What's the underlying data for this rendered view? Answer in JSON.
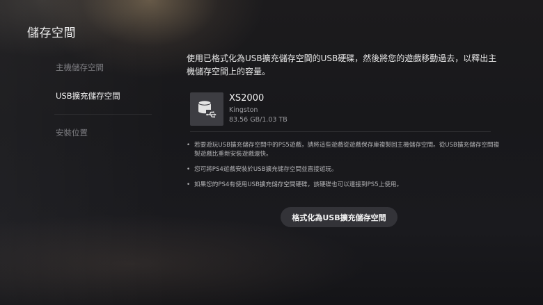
{
  "header": {
    "title": "儲存空間"
  },
  "sidebar": {
    "items": [
      {
        "label": "主機儲存空間",
        "active": false
      },
      {
        "label": "USB擴充儲存空間",
        "active": true
      },
      {
        "label": "安裝位置",
        "active": false
      }
    ]
  },
  "main": {
    "description": "使用已格式化為USB擴充儲存空間的USB硬碟，然後將您的遊戲移動過去，以釋出主機儲存空間上的容量。",
    "device": {
      "icon": "usb-drive-icon",
      "name": "XS2000",
      "brand": "Kingston",
      "capacity": "83.56 GB/1.03 TB"
    },
    "notes": [
      "若要遊玩USB擴充儲存空間中的PS5遊戲，請將這些遊戲從遊戲保存庫複製回主機儲存空間。從USB擴充儲存空間複製遊戲比重新安裝遊戲還快。",
      "您可將PS4遊戲安裝於USB擴充儲存空間並直接遊玩。",
      "如果您的PS4有使用USB擴充儲存空間硬碟，該硬碟也可以連接到PS5上使用。"
    ],
    "format_button_label": "格式化為USB擴充儲存空間"
  }
}
